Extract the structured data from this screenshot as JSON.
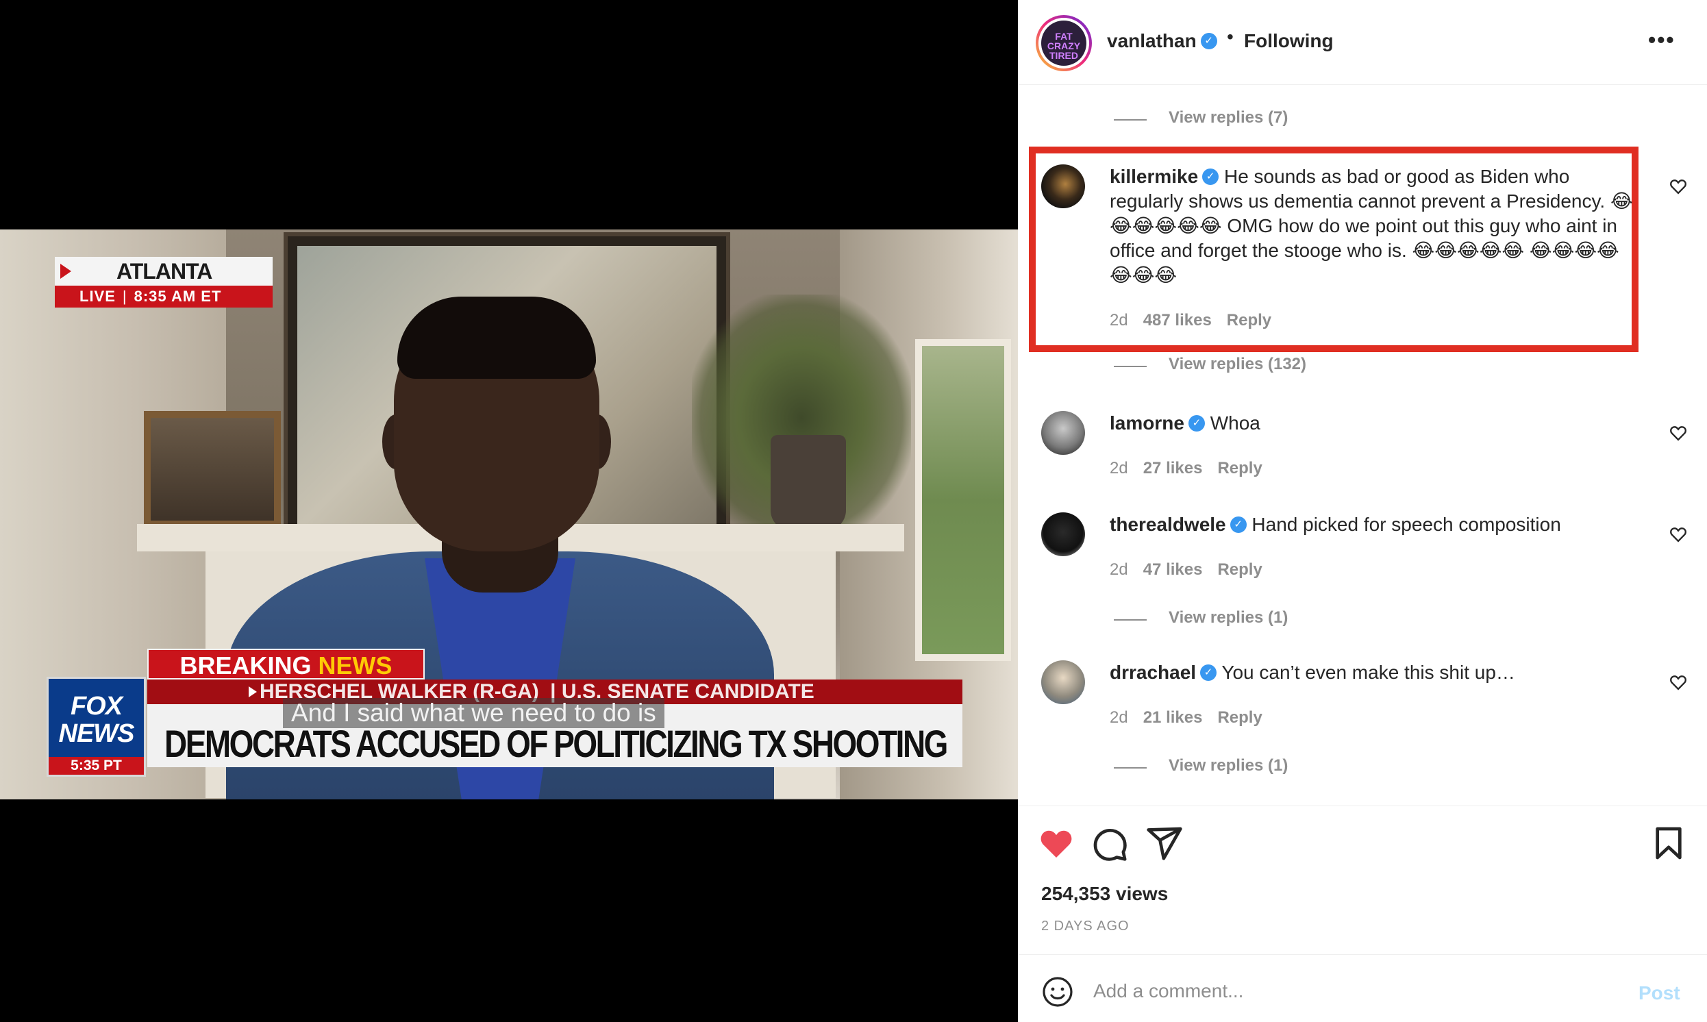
{
  "video": {
    "location": "ATLANTA",
    "live_label": "LIVE",
    "live_time": "8:35 AM ET",
    "breaking": "BREAKING",
    "news": "NEWS",
    "network_line1": "FOX",
    "network_line2": "NEWS",
    "network_time": "5:35 PT",
    "name_bar": "HERSCHEL WALKER (R-GA)",
    "name_bar_role": "| U.S. SENATE CANDIDATE",
    "headline": "DEMOCRATS ACCUSED OF POLITICIZING TX SHOOTING",
    "caption": "And I said what we need to do is"
  },
  "post_header": {
    "username": "vanlathan",
    "dot": "•",
    "follow_status": "Following",
    "avatar_text": "FAT CRAZY TIRED"
  },
  "comments": [
    {
      "view_replies_above": "View replies (7)"
    },
    {
      "username": "killermike",
      "text": "He sounds as bad or good as Biden who regularly shows us dementia cannot prevent a Presidency. 😂😂😂😂😂😂 OMG how do we point out this guy who aint in office and forget the stooge who is. 😂😂😂😂😂 😂😂😂😂😂😂😂",
      "age": "2d",
      "likes": "487 likes",
      "reply": "Reply",
      "view_replies": "View replies (132)",
      "highlighted": true
    },
    {
      "username": "lamorne",
      "text": "Whoa",
      "age": "2d",
      "likes": "27 likes",
      "reply": "Reply"
    },
    {
      "username": "therealdwele",
      "text": "Hand picked for speech composition",
      "age": "2d",
      "likes": "47 likes",
      "reply": "Reply",
      "view_replies": "View replies (1)"
    },
    {
      "username": "drrachael",
      "text": "You can’t even make this shit up…",
      "age": "2d",
      "likes": "21 likes",
      "reply": "Reply",
      "view_replies": "View replies (1)"
    }
  ],
  "actions": {
    "liked": true,
    "like_color": "#ed4956",
    "icons": [
      "heart-icon",
      "comment-icon",
      "share-icon",
      "bookmark-icon"
    ]
  },
  "stats": {
    "views": "254,353 views",
    "posted": "2 DAYS AGO"
  },
  "add_comment": {
    "placeholder": "Add a comment...",
    "post_label": "Post"
  },
  "colors": {
    "highlight_border": "#e02e22",
    "verified_blue": "#3897f0",
    "muted_text": "#8e8e8e",
    "post_button_disabled": "#b2dffc"
  }
}
